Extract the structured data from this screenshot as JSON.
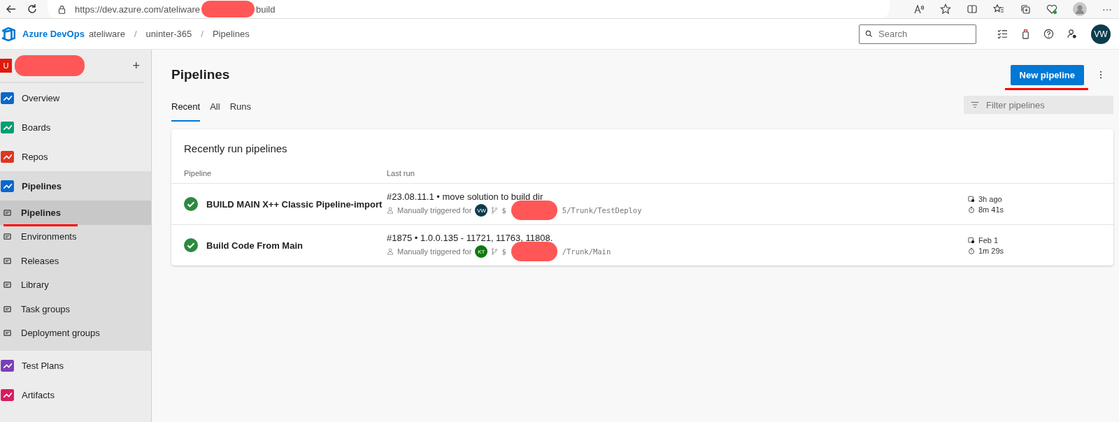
{
  "browser": {
    "url_start": "https://dev.azure.com/ateliware",
    "url_end": "build",
    "more": "···"
  },
  "header": {
    "product": "Azure DevOps",
    "breadcrumbs": [
      "ateliware",
      "uninter-365",
      "Pipelines"
    ],
    "separator": "/",
    "search": {
      "placeholder": "Search"
    },
    "avatar": "VW"
  },
  "sidebar": {
    "project": {
      "initial": "U",
      "add": "+"
    },
    "items": [
      {
        "label": "Overview",
        "selected": false
      },
      {
        "label": "Boards",
        "selected": false
      },
      {
        "label": "Repos",
        "selected": false
      },
      {
        "label": "Pipelines",
        "selected": false,
        "expanded": true,
        "children": [
          {
            "label": "Pipelines",
            "selected": true
          },
          {
            "label": "Environments",
            "selected": false
          },
          {
            "label": "Releases",
            "selected": false
          },
          {
            "label": "Library",
            "selected": false
          },
          {
            "label": "Task groups",
            "selected": false
          },
          {
            "label": "Deployment groups",
            "selected": false
          }
        ]
      },
      {
        "label": "Test Plans",
        "selected": false
      },
      {
        "label": "Artifacts",
        "selected": false
      }
    ]
  },
  "page": {
    "title": "Pipelines",
    "new_button": "New pipeline",
    "filter": {
      "placeholder": "Filter pipelines"
    },
    "tabs": [
      {
        "label": "Recent",
        "selected": true
      },
      {
        "label": "All",
        "selected": false
      },
      {
        "label": "Runs",
        "selected": false
      }
    ],
    "card": {
      "title": "Recently run pipelines",
      "columns": [
        "Pipeline",
        "Last run"
      ],
      "rows": [
        {
          "name": "BUILD MAIN X++ Classic Pipeline-import",
          "succeeded": true,
          "run": "#23.08.11.1 • move solution to build dir",
          "trigger": "Manually triggered for",
          "user": {
            "initials": "VW",
            "color": "#0b3c4d"
          },
          "branch_start": "$",
          "branch_end": "5/Trunk/TestDeploy",
          "when": "3h ago",
          "duration": "8m 41s"
        },
        {
          "name": "Build Code From Main",
          "succeeded": true,
          "run": "#1875 • 1.0.0.135 - 11721, 11763, 11808.",
          "trigger": "Manually triggered for",
          "user": {
            "initials": "KT",
            "color": "#0e7a0d"
          },
          "branch_start": "$",
          "branch_end": "/Trunk/Main",
          "when": "Feb 1",
          "duration": "1m 29s"
        }
      ]
    }
  }
}
